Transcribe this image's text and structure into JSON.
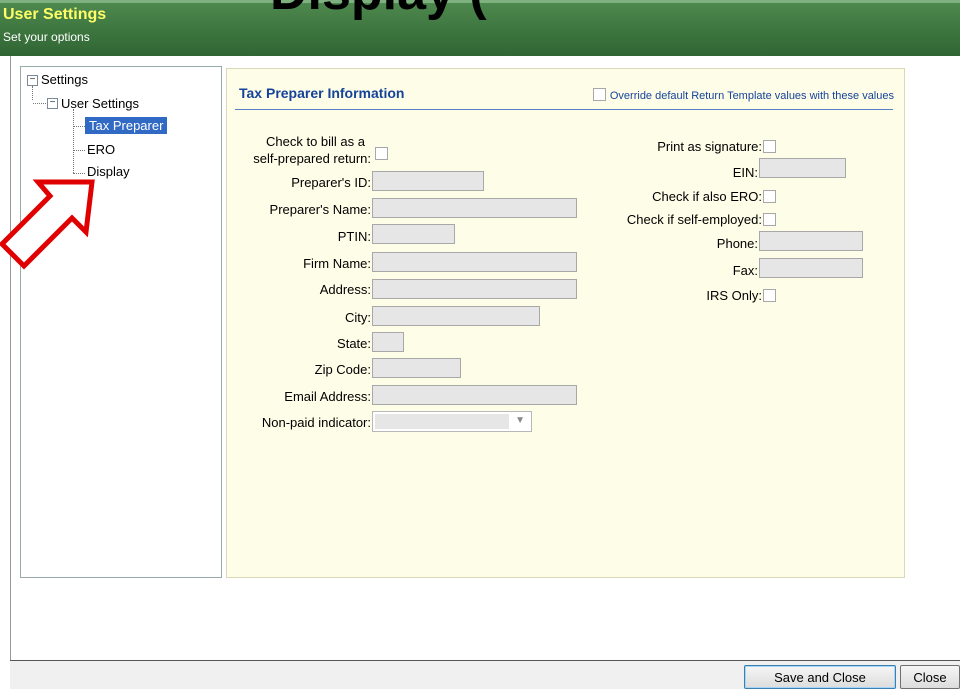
{
  "header": {
    "ghost_text": "Display (",
    "title": "User Settings",
    "subtitle": "Set your options"
  },
  "tree": {
    "root": "Settings",
    "group": "User Settings",
    "items": [
      {
        "label": "Tax Preparer",
        "selected": true
      },
      {
        "label": "ERO",
        "selected": false
      },
      {
        "label": "Display",
        "selected": false
      }
    ]
  },
  "form": {
    "section_title": "Tax Preparer Information",
    "override_label": "Override default Return Template values with these values",
    "left_fields": {
      "bill_self_line1": "Check to bill as a",
      "bill_self_line2": "self-prepared return:",
      "preparer_id": "Preparer's ID:",
      "preparer_name": "Preparer's Name:",
      "ptin": "PTIN:",
      "firm_name": "Firm Name:",
      "address": "Address:",
      "city": "City:",
      "state": "State:",
      "zip": "Zip Code:",
      "email": "Email Address:",
      "non_paid": "Non-paid indicator:"
    },
    "right_fields": {
      "print_signature": "Print as signature:",
      "ein": "EIN:",
      "also_ero": "Check if also ERO:",
      "self_employed": "Check if self-employed:",
      "phone": "Phone:",
      "fax": "Fax:",
      "irs_only": "IRS Only:"
    }
  },
  "footer": {
    "save_label": "Save and Close",
    "close_label": "Close"
  },
  "colors": {
    "header_green": "#2f6532",
    "title_yellow": "#ffff66",
    "section_blue": "#15439a",
    "selection_blue": "#316ac5",
    "annotation_red": "#e00000"
  }
}
